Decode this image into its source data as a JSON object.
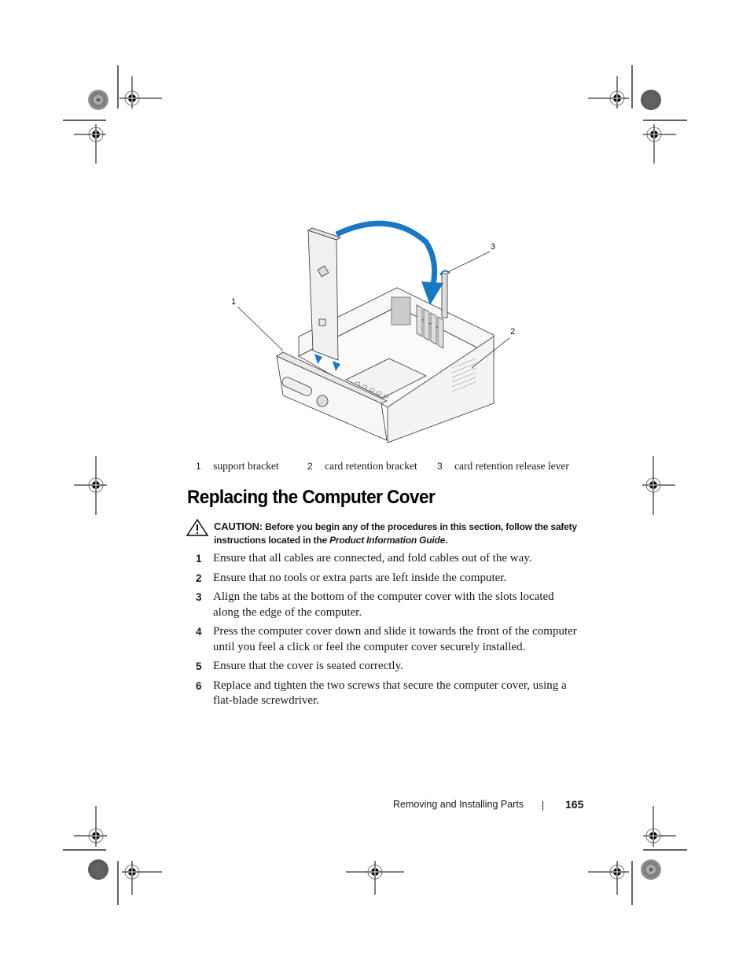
{
  "figure": {
    "callouts": [
      "1",
      "2",
      "3"
    ],
    "arrow_color": "#1a78c2",
    "legend": [
      {
        "num": "1",
        "label": "support bracket"
      },
      {
        "num": "2",
        "label": "card retention bracket"
      },
      {
        "num": "3",
        "label": "card retention release lever"
      }
    ]
  },
  "section": {
    "title": "Replacing the Computer Cover"
  },
  "caution": {
    "icon": "warning-triangle-icon",
    "label": "CAUTION:",
    "text_before": " Before you begin any of the procedures in this section, follow the safety instructions located in the ",
    "emphasis": "Product Information Guide",
    "text_after": "."
  },
  "steps": [
    {
      "num": "1",
      "text": "Ensure that all cables are connected, and fold cables out of the way."
    },
    {
      "num": "2",
      "text": "Ensure that no tools or extra parts are left inside the computer."
    },
    {
      "num": "3",
      "text": "Align the tabs at the bottom of the computer cover with the slots located along the edge of the computer."
    },
    {
      "num": "4",
      "text": "Press the computer cover down and slide it towards the front of the computer until you feel a click or feel the computer cover securely installed."
    },
    {
      "num": "5",
      "text": "Ensure that the cover is seated correctly."
    },
    {
      "num": "6",
      "text": "Replace and tighten the two screws that secure the computer cover, using a flat-blade screwdriver."
    }
  ],
  "footer": {
    "section_name": "Removing and Installing Parts",
    "page_number": "165"
  }
}
